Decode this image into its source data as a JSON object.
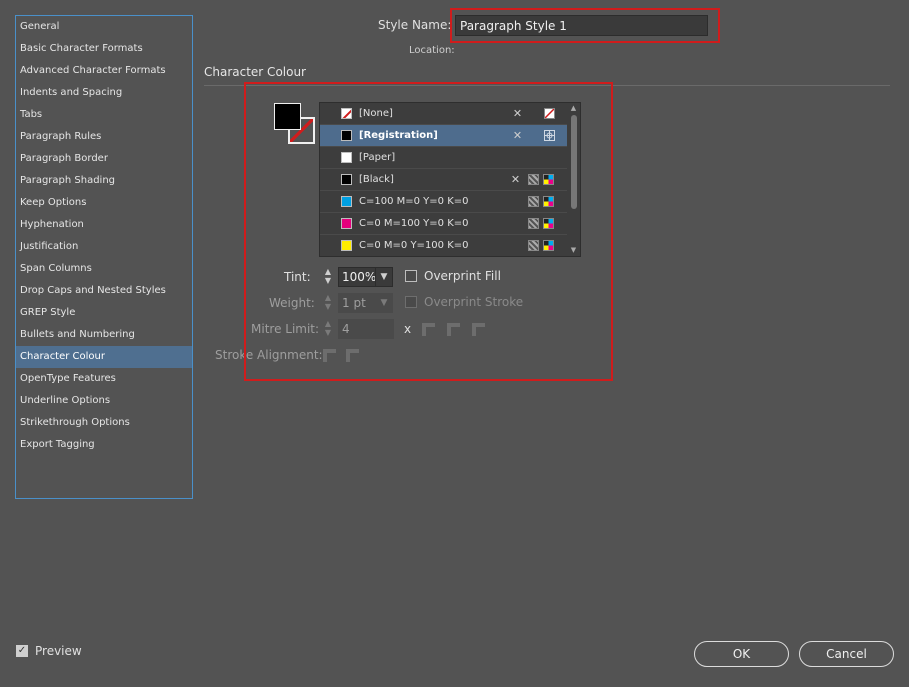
{
  "sidebar": {
    "items": [
      {
        "label": "General"
      },
      {
        "label": "Basic Character Formats"
      },
      {
        "label": "Advanced Character Formats"
      },
      {
        "label": "Indents and Spacing"
      },
      {
        "label": "Tabs"
      },
      {
        "label": "Paragraph Rules"
      },
      {
        "label": "Paragraph Border"
      },
      {
        "label": "Paragraph Shading"
      },
      {
        "label": "Keep Options"
      },
      {
        "label": "Hyphenation"
      },
      {
        "label": "Justification"
      },
      {
        "label": "Span Columns"
      },
      {
        "label": "Drop Caps and Nested Styles"
      },
      {
        "label": "GREP Style"
      },
      {
        "label": "Bullets and Numbering"
      },
      {
        "label": "Character Colour",
        "selected": true
      },
      {
        "label": "OpenType Features"
      },
      {
        "label": "Underline Options"
      },
      {
        "label": "Strikethrough Options"
      },
      {
        "label": "Export Tagging"
      }
    ]
  },
  "header": {
    "style_name_label": "Style Name:",
    "style_name_value": "Paragraph Style 1",
    "location_label": "Location:",
    "section_title": "Character Colour"
  },
  "swatches": [
    {
      "label": "[None]",
      "chip": "none",
      "icons": [
        "pencil-crossed-icon",
        "none-swatch-icon"
      ]
    },
    {
      "label": "[Registration]",
      "chip": "#000000",
      "selected": true,
      "icons": [
        "pencil-crossed-icon",
        "registration-icon"
      ]
    },
    {
      "label": "[Paper]",
      "chip": "#ffffff",
      "icons": []
    },
    {
      "label": "[Black]",
      "chip": "#000000",
      "icons": [
        "pencil-crossed-icon",
        "process-color-icon",
        "cmyk-icon"
      ]
    },
    {
      "label": "C=100 M=0 Y=0 K=0",
      "chip": "#00a0e3",
      "icons": [
        "process-color-icon",
        "cmyk-icon"
      ]
    },
    {
      "label": "C=0 M=100 Y=0 K=0",
      "chip": "#e4007c",
      "icons": [
        "process-color-icon",
        "cmyk-icon"
      ]
    },
    {
      "label": "C=0 M=0 Y=100 K=0",
      "chip": "#ffed00",
      "icons": [
        "process-color-icon",
        "cmyk-icon"
      ]
    }
  ],
  "properties": {
    "tint_label": "Tint:",
    "tint_value": "100%",
    "overprint_fill_label": "Overprint Fill",
    "weight_label": "Weight:",
    "weight_value": "1 pt",
    "overprint_stroke_label": "Overprint Stroke",
    "mitre_label": "Mitre Limit:",
    "mitre_value": "4",
    "mitre_x": "x",
    "stroke_alignment_label": "Stroke Alignment:"
  },
  "footer": {
    "preview_label": "Preview",
    "preview_checked": true,
    "ok_label": "OK",
    "cancel_label": "Cancel"
  },
  "colors": {
    "accent": "#4f6f90",
    "highlight_border": "#d01c1c",
    "background": "#535353"
  }
}
